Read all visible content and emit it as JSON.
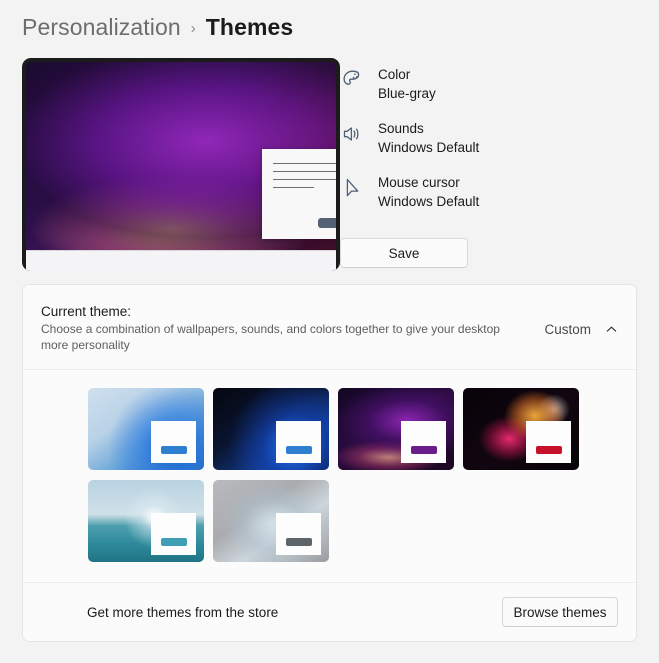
{
  "breadcrumb": {
    "parent": "Personalization",
    "separator": "›",
    "current": "Themes"
  },
  "preview": {
    "wallpaper_name": "purple-glow-wallpaper",
    "mock_window_name": "mock-app-window"
  },
  "settings": {
    "rows": [
      {
        "icon": "palette-icon",
        "title": "Color",
        "value": "Blue-gray"
      },
      {
        "icon": "speaker-icon",
        "title": "Sounds",
        "value": "Windows Default"
      },
      {
        "icon": "cursor-icon",
        "title": "Mouse cursor",
        "value": "Windows Default"
      }
    ],
    "save_label": "Save"
  },
  "current_theme": {
    "title": "Current theme:",
    "description": "Choose a combination of wallpapers, sounds, and colors together to give your desktop more personality",
    "value": "Custom",
    "expand_icon": "chevron-up-icon"
  },
  "themes": [
    {
      "name": "windows-bloom-light",
      "style": "wp-bloom-light",
      "accent": "#2f7fd0"
    },
    {
      "name": "windows-bloom-dark",
      "style": "wp-bloom-dark",
      "accent": "#2f7fd0"
    },
    {
      "name": "glow-purple",
      "style": "wp-glow",
      "accent": "#6b1d8c"
    },
    {
      "name": "flora-dark",
      "style": "wp-flora",
      "accent": "#c7102a"
    },
    {
      "name": "captured-motion-lake",
      "style": "wp-lake",
      "accent": "#3e9fb5"
    },
    {
      "name": "flow-gray",
      "style": "wp-flow-gray",
      "accent": "#5e6468"
    }
  ],
  "store": {
    "text": "Get more themes from the store",
    "button_label": "Browse themes"
  },
  "colors": {
    "page_background": "#f3f3f3",
    "card_background": "#fbfbfb",
    "card_border": "#e5e5e5",
    "text_primary": "#1b1b1b",
    "text_secondary": "#5e5e5e",
    "icon_stroke": "#4e6076"
  }
}
